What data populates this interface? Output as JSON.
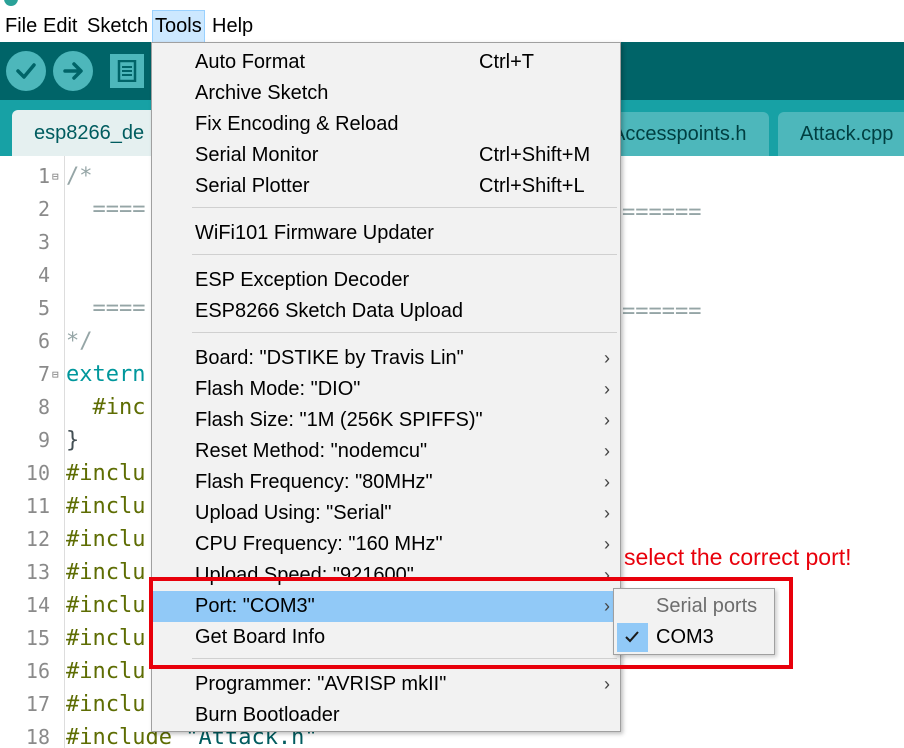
{
  "menubar": {
    "items": [
      {
        "label": "File"
      },
      {
        "label": "Edit"
      },
      {
        "label": "Sketch"
      },
      {
        "label": "Tools"
      },
      {
        "label": "Help"
      }
    ]
  },
  "tabs": [
    {
      "label": "esp8266_de"
    },
    {
      "label": "Accesspoints.h"
    },
    {
      "label": "Attack.cpp"
    }
  ],
  "editor": {
    "line_numbers": [
      "1",
      "2",
      "3",
      "4",
      "5",
      "6",
      "7",
      "8",
      "9",
      "10",
      "11",
      "12",
      "13",
      "14",
      "15",
      "16",
      "17",
      "18"
    ],
    "lines": [
      {
        "tokens": [
          {
            "t": "/*",
            "c": "cm"
          }
        ]
      },
      {
        "tokens": [
          {
            "t": "  ====",
            "c": "cm"
          }
        ]
      },
      {
        "tokens": [
          {
            "t": "",
            "c": "cm"
          }
        ]
      },
      {
        "tokens": [
          {
            "t": "",
            "c": "cm"
          }
        ]
      },
      {
        "tokens": [
          {
            "t": "  ====",
            "c": "cm"
          }
        ]
      },
      {
        "tokens": [
          {
            "t": "*/",
            "c": "cm"
          }
        ]
      },
      {
        "tokens": [
          {
            "t": "extern",
            "c": "kw"
          }
        ]
      },
      {
        "tokens": [
          {
            "t": "  #inc",
            "c": "pp"
          }
        ]
      },
      {
        "tokens": [
          {
            "t": "}",
            "c": ""
          }
        ]
      },
      {
        "tokens": [
          {
            "t": "#inclu",
            "c": "pp"
          }
        ]
      },
      {
        "tokens": [
          {
            "t": "#inclu",
            "c": "pp"
          }
        ]
      },
      {
        "tokens": [
          {
            "t": "#inclu",
            "c": "pp"
          }
        ]
      },
      {
        "tokens": [
          {
            "t": "#inclu",
            "c": "pp"
          }
        ]
      },
      {
        "tokens": [
          {
            "t": "#inclu",
            "c": "pp"
          }
        ]
      },
      {
        "tokens": [
          {
            "t": "#inclu",
            "c": "pp"
          }
        ]
      },
      {
        "tokens": [
          {
            "t": "#inclu",
            "c": "pp"
          }
        ]
      },
      {
        "tokens": [
          {
            "t": "#inclu",
            "c": "pp"
          }
        ]
      },
      {
        "tokens": [
          {
            "t": "#include ",
            "c": "pp"
          },
          {
            "t": "\"Attack.h\"",
            "c": "str"
          }
        ]
      }
    ],
    "right_fragments": [
      "======",
      "",
      "======"
    ]
  },
  "tools_menu": {
    "items": [
      {
        "label": "Auto Format",
        "shortcut": "Ctrl+T"
      },
      {
        "label": "Archive Sketch",
        "shortcut": ""
      },
      {
        "label": "Fix Encoding & Reload",
        "shortcut": ""
      },
      {
        "label": "Serial Monitor",
        "shortcut": "Ctrl+Shift+M"
      },
      {
        "label": "Serial Plotter",
        "shortcut": "Ctrl+Shift+L"
      },
      {
        "label": "WiFi101 Firmware Updater",
        "shortcut": ""
      },
      {
        "label": "ESP Exception Decoder",
        "shortcut": ""
      },
      {
        "label": "ESP8266 Sketch Data Upload",
        "shortcut": ""
      },
      {
        "label": "Board: \"DSTIKE by Travis Lin\"",
        "shortcut": ""
      },
      {
        "label": "Flash Mode: \"DIO\"",
        "shortcut": ""
      },
      {
        "label": "Flash Size: \"1M (256K SPIFFS)\"",
        "shortcut": ""
      },
      {
        "label": "Reset Method: \"nodemcu\"",
        "shortcut": ""
      },
      {
        "label": "Flash Frequency: \"80MHz\"",
        "shortcut": ""
      },
      {
        "label": "Upload Using: \"Serial\"",
        "shortcut": ""
      },
      {
        "label": "CPU Frequency: \"160 MHz\"",
        "shortcut": ""
      },
      {
        "label": "Upload Speed: \"921600\"",
        "shortcut": ""
      },
      {
        "label": "Port: \"COM3\"",
        "shortcut": ""
      },
      {
        "label": "Get Board Info",
        "shortcut": ""
      },
      {
        "label": "Programmer: \"AVRISP mkII\"",
        "shortcut": ""
      },
      {
        "label": "Burn Bootloader",
        "shortcut": ""
      }
    ]
  },
  "port_submenu": {
    "header": "Serial ports",
    "items": [
      {
        "label": "COM3",
        "checked": true
      }
    ]
  },
  "annotation": {
    "text": "select the correct port!",
    "color": "#e8000b"
  },
  "colors": {
    "toolbar": "#006468",
    "tabsbar": "#17a1a5",
    "highlight": "#91c9f7"
  }
}
